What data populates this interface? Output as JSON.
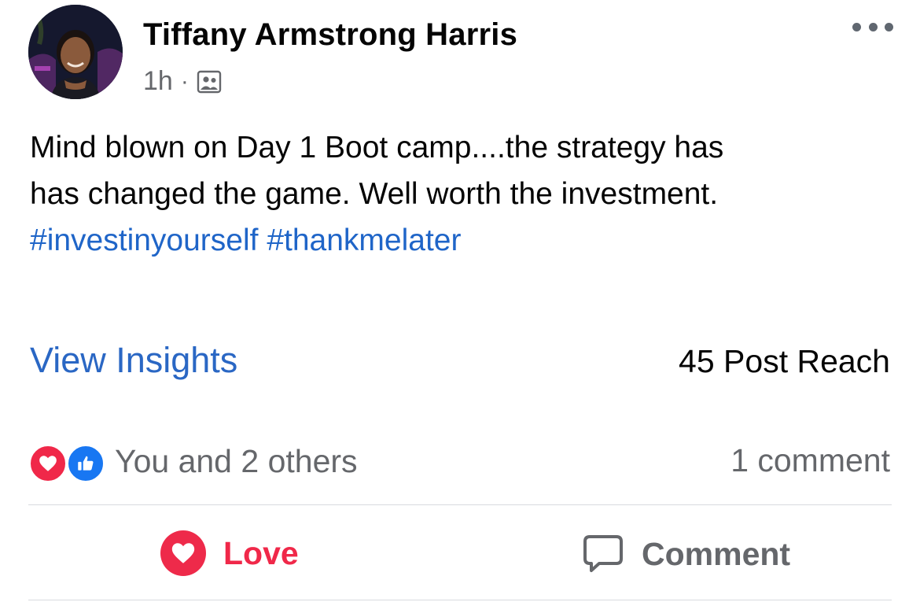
{
  "post": {
    "author": "Tiffany Armstrong Harris",
    "time": "1h",
    "separator": "·",
    "audience_icon": "friends-audience-icon",
    "text_line1": "Mind blown on Day 1 Boot camp....the strategy has",
    "text_line2": "has changed the game. Well worth the investment.",
    "hashtags": [
      "#investinyourself",
      "#thankmelater"
    ]
  },
  "insights": {
    "view_label": "View Insights",
    "reach_text": "45 Post Reach"
  },
  "engagement": {
    "reaction_icons": [
      "love-reaction-icon",
      "like-reaction-icon"
    ],
    "reaction_summary": "You and 2 others",
    "comment_count": "1 comment"
  },
  "actions": {
    "love_label": "Love",
    "comment_label": "Comment"
  },
  "colors": {
    "link_blue": "#1f65c8",
    "love_red": "#f02849",
    "like_blue": "#1877f2",
    "secondary_gray": "#65676b"
  }
}
